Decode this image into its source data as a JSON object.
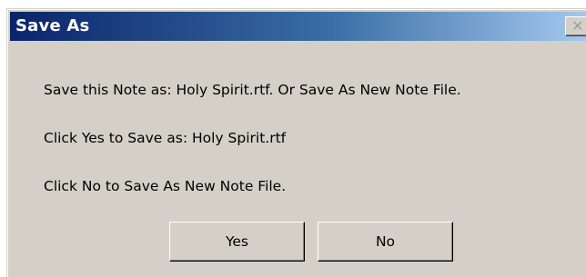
{
  "dialog": {
    "title": "Save As",
    "close_glyph": "✕",
    "messages": [
      "Save this Note as:  Holy Spirit.rtf.  Or Save As New Note File.",
      "Click Yes to Save as: Holy Spirit.rtf",
      "Click No to Save As New Note File."
    ],
    "buttons": {
      "yes_label": "Yes",
      "no_label": "No"
    }
  },
  "colors": {
    "titlebar_start": "#0a246a",
    "titlebar_end": "#a6caf0",
    "window_bg": "#d4d0c8"
  },
  "icons": {
    "close": "close-icon"
  }
}
